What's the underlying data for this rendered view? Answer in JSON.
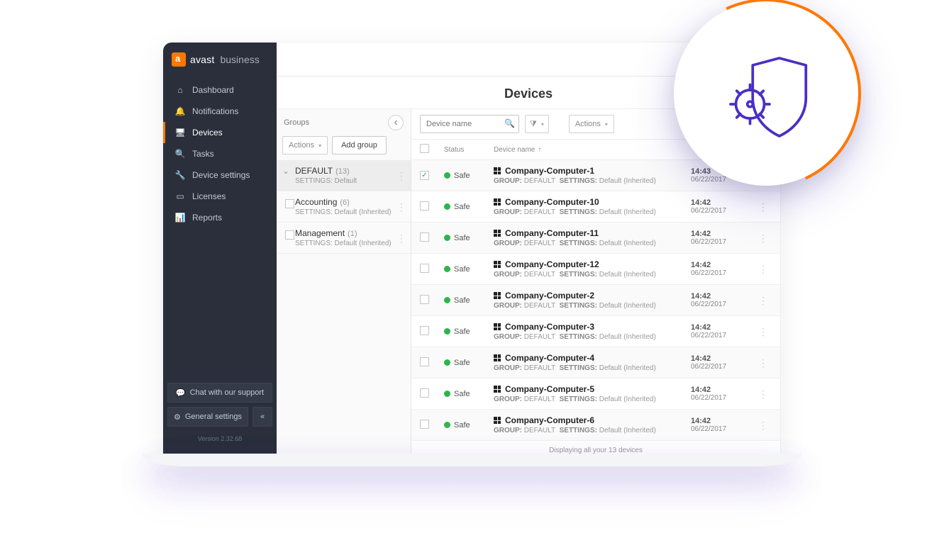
{
  "brand": {
    "name": "avast",
    "suffix": "business"
  },
  "page_title": "Devices",
  "sidebar": {
    "items": [
      {
        "label": "Dashboard",
        "icon": "home-icon"
      },
      {
        "label": "Notifications",
        "icon": "bell-icon"
      },
      {
        "label": "Devices",
        "icon": "monitor-icon",
        "active": true
      },
      {
        "label": "Tasks",
        "icon": "search-icon"
      },
      {
        "label": "Device settings",
        "icon": "wrench-icon"
      },
      {
        "label": "Licenses",
        "icon": "card-icon"
      },
      {
        "label": "Reports",
        "icon": "bar-chart-icon"
      }
    ],
    "footer": {
      "chat_label": "Chat with our support",
      "settings_label": "General settings",
      "version": "Version 2.32.68"
    }
  },
  "groups": {
    "title": "Groups",
    "actions_label": "Actions",
    "add_group_label": "Add group",
    "items": [
      {
        "name": "DEFAULT",
        "count": 13,
        "settings": "SETTINGS: Default",
        "root": true
      },
      {
        "name": "Accounting",
        "count": 6,
        "settings": "SETTINGS: Default (Inherited)"
      },
      {
        "name": "Management",
        "count": 1,
        "settings": "SETTINGS: Default (Inherited)"
      }
    ]
  },
  "devices": {
    "search_placeholder": "Device name",
    "actions_label": "Actions",
    "columns": {
      "status": "Status",
      "name": "Device name"
    },
    "status_safe": "Safe",
    "meta_group_label": "GROUP:",
    "meta_group_value": "DEFAULT",
    "meta_settings_label": "SETTINGS:",
    "meta_settings_value": "Default (Inherited)",
    "rows": [
      {
        "name": "Company-Computer-1",
        "time": "14:43",
        "date": "06/22/2017",
        "checked": true
      },
      {
        "name": "Company-Computer-10",
        "time": "14:42",
        "date": "06/22/2017"
      },
      {
        "name": "Company-Computer-11",
        "time": "14:42",
        "date": "06/22/2017"
      },
      {
        "name": "Company-Computer-12",
        "time": "14:42",
        "date": "06/22/2017"
      },
      {
        "name": "Company-Computer-2",
        "time": "14:42",
        "date": "06/22/2017"
      },
      {
        "name": "Company-Computer-3",
        "time": "14:42",
        "date": "06/22/2017"
      },
      {
        "name": "Company-Computer-4",
        "time": "14:42",
        "date": "06/22/2017"
      },
      {
        "name": "Company-Computer-5",
        "time": "14:42",
        "date": "06/22/2017"
      },
      {
        "name": "Company-Computer-6",
        "time": "14:42",
        "date": "06/22/2017"
      }
    ],
    "footer": "Displaying all your 13 devices"
  }
}
